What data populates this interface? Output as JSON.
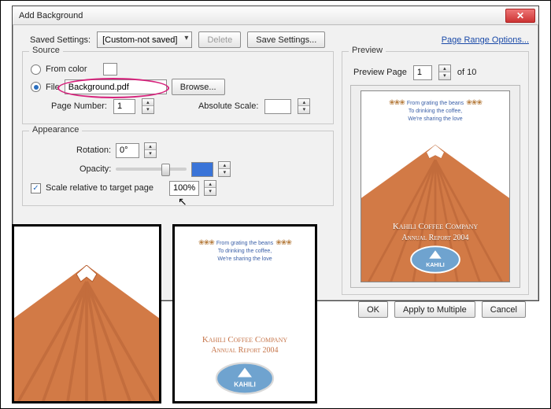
{
  "window": {
    "title": "Add Background"
  },
  "toolbar": {
    "saved_settings_label": "Saved Settings:",
    "saved_settings_value": "[Custom-not saved]",
    "delete": "Delete",
    "save_settings": "Save Settings...",
    "page_range_link": "Page Range Options..."
  },
  "source": {
    "legend": "Source",
    "from_color_label": "From color",
    "file_label": "File",
    "file_value": "Background.pdf",
    "browse": "Browse...",
    "page_number_label": "Page Number:",
    "page_number_value": "1",
    "absolute_scale_label": "Absolute Scale:",
    "absolute_scale_value": ""
  },
  "appearance": {
    "legend": "Appearance",
    "rotation_label": "Rotation:",
    "rotation_value": "0°",
    "opacity_label": "Opacity:",
    "opacity_value": "",
    "scale_relative_label": "Scale relative to target page",
    "scale_relative_value": "100%"
  },
  "preview": {
    "legend": "Preview",
    "page_label": "Preview Page",
    "page_value": "1",
    "of": "of 10",
    "quote1": "From grating the beans",
    "quote2": "To drinking the coffee,",
    "quote3": "We're sharing the love",
    "company": "Kahili Coffee Company",
    "subtitle": "Annual Report 2004",
    "logo_text": "KAHILI"
  },
  "buttons": {
    "ok": "OK",
    "apply": "Apply to Multiple",
    "cancel": "Cancel"
  }
}
